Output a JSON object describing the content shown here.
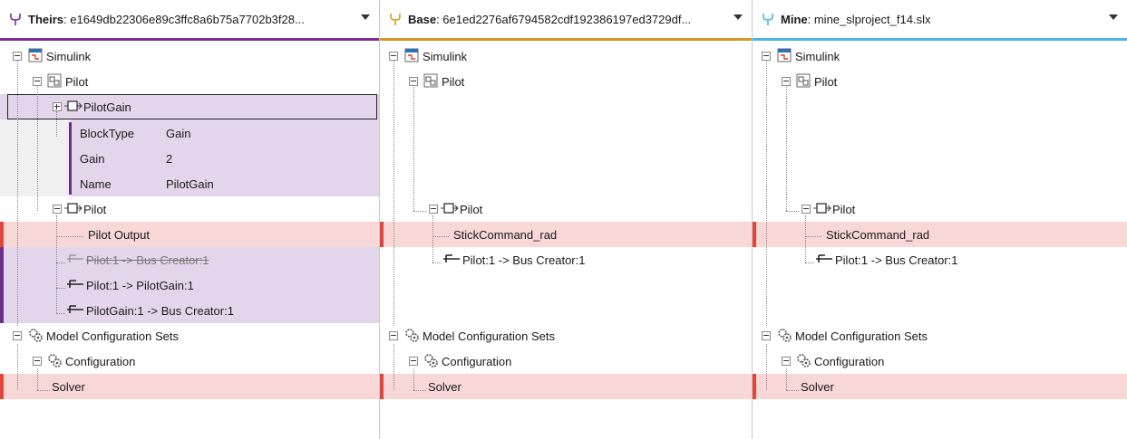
{
  "colors": {
    "theirs": "#7b2d9a",
    "base": "#d39b1e",
    "mine": "#4cb6e3",
    "conflict_bg": "#f8d7d7",
    "conflict_mark": "#e0443b",
    "change_bg": "#e4d6ea",
    "change_mark": "#6a2c8e",
    "grey_bg": "#f0f0f0"
  },
  "panes": [
    {
      "id": "theirs",
      "label": "Theirs",
      "value": ": e1649db22306e89c3ffc8a6b75a7702b3f28...",
      "color": "#7b2d9a",
      "icon": "fork-icon"
    },
    {
      "id": "base",
      "label": "Base",
      "value": ": 6e1ed2276af6794582cdf192386197ed3729df...",
      "color": "#d39b1e",
      "icon": "fork-icon"
    },
    {
      "id": "mine",
      "label": "Mine",
      "value": ": mine_slproject_f14.slx",
      "color": "#4cb6e3",
      "icon": "fork-icon"
    }
  ],
  "tree": {
    "simulink": "Simulink",
    "pilot_subsystem": "Pilot",
    "pilot_gain": "PilotGain",
    "props": [
      {
        "name": "BlockType",
        "value": "Gain"
      },
      {
        "name": "Gain",
        "value": "2"
      },
      {
        "name": "Name",
        "value": "PilotGain"
      }
    ],
    "pilot_block": "Pilot",
    "theirs_port": "Pilot Output",
    "other_port": "StickCommand_rad",
    "line_deleted": "Pilot:1 -> Bus Creator:1",
    "line_pilot_gain": "Pilot:1 -> PilotGain:1",
    "line_gain_bus": "PilotGain:1 -> Bus Creator:1",
    "line_pilot_bus": "Pilot:1 -> Bus Creator:1",
    "config_sets": "Model Configuration Sets",
    "configuration": "Configuration",
    "solver": "Solver"
  }
}
